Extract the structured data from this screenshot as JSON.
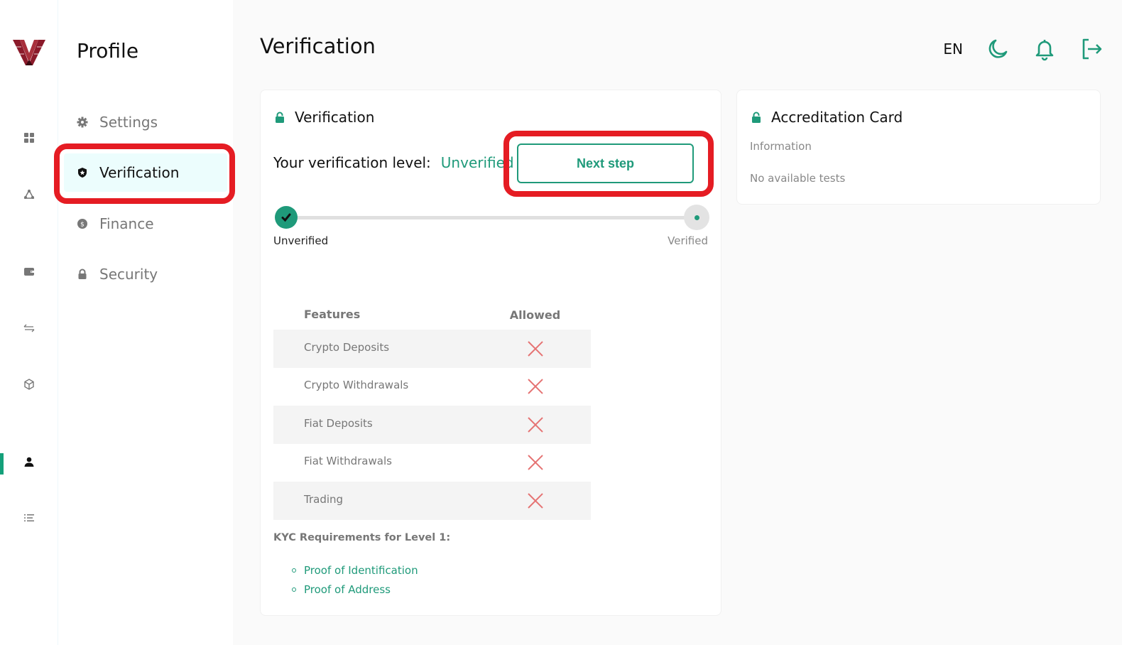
{
  "colors": {
    "accent": "#1f9a7a",
    "danger": "#e57373",
    "highlight": "#e51c23"
  },
  "rail": {
    "items": [
      {
        "icon": "dashboard-icon",
        "active": false
      },
      {
        "icon": "network-icon",
        "active": false
      },
      {
        "icon": "wallet-icon",
        "active": false
      },
      {
        "icon": "transfer-icon",
        "active": false
      },
      {
        "icon": "cube-icon",
        "active": false
      },
      {
        "icon": "user-icon",
        "active": true
      },
      {
        "icon": "list-icon",
        "active": false
      }
    ]
  },
  "subnav": {
    "title": "Profile",
    "items": [
      {
        "label": "Settings",
        "icon": "gear-icon",
        "active": false
      },
      {
        "label": "Verification",
        "icon": "shield-icon",
        "active": true
      },
      {
        "label": "Finance",
        "icon": "dollar-icon",
        "active": false
      },
      {
        "label": "Security",
        "icon": "lock-icon",
        "active": false
      }
    ]
  },
  "header": {
    "title": "Verification",
    "language": "EN",
    "icons": [
      "moon-icon",
      "bell-icon",
      "logout-icon"
    ]
  },
  "verification_card": {
    "title": "Verification",
    "level_label": "Your verification level:",
    "level_value": "Unverified",
    "next_button": "Next step",
    "progress": {
      "current_step": 1,
      "total_steps": 2,
      "steps": [
        {
          "label": "Unverified",
          "done": true
        },
        {
          "label": "Verified",
          "done": false
        }
      ]
    },
    "features_table": {
      "headers": [
        "Features",
        "Allowed"
      ],
      "rows": [
        {
          "feature": "Crypto Deposits",
          "allowed": false
        },
        {
          "feature": "Crypto Withdrawals",
          "allowed": false
        },
        {
          "feature": "Fiat Deposits",
          "allowed": false
        },
        {
          "feature": "Fiat Withdrawals",
          "allowed": false
        },
        {
          "feature": "Trading",
          "allowed": false
        }
      ]
    },
    "kyc": {
      "title": "KYC Requirements for Level 1:",
      "items": [
        "Proof of Identification",
        "Proof of Address"
      ]
    }
  },
  "accreditation_card": {
    "title": "Accreditation Card",
    "subtitle": "Information",
    "empty_text": "No available tests"
  }
}
